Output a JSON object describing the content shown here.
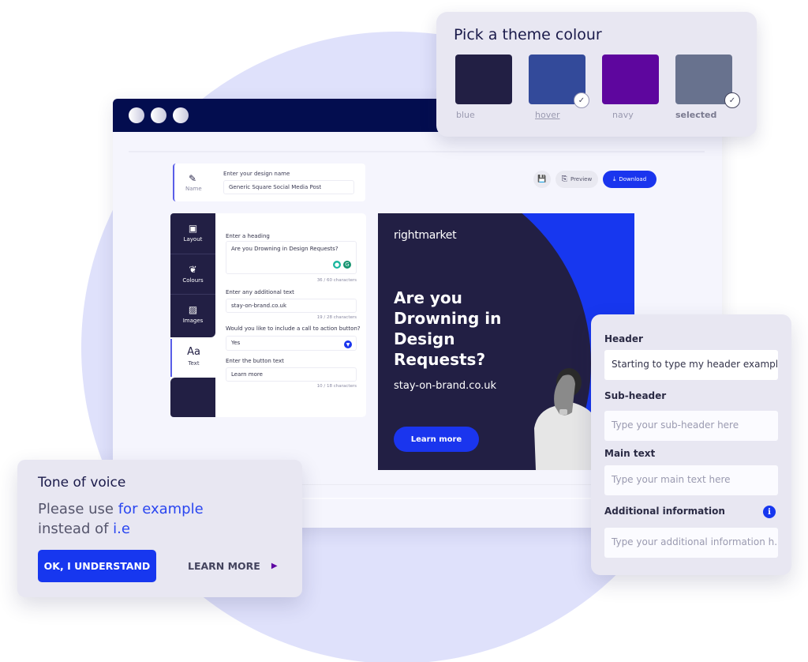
{
  "theme_picker": {
    "title": "Pick a theme colour",
    "swatches": [
      {
        "label": "blue",
        "color": "#221f44",
        "state": "default"
      },
      {
        "label": "hover",
        "color": "#334a9a",
        "state": "hover"
      },
      {
        "label": "navy",
        "color": "#5e069e",
        "state": "default"
      },
      {
        "label": "selected",
        "color": "#68728e",
        "state": "selected"
      }
    ],
    "check_glyph": "✓"
  },
  "window": {
    "titlebar_color": "#030d4f",
    "design_name": {
      "icon": "pencil-icon",
      "icon_glyph": "✎",
      "tab_label": "Name",
      "field_label": "Enter your design name",
      "value": "Generic Square Social Media Post"
    },
    "toolbar": {
      "save_glyph": "💾",
      "preview_glyph": "⎘",
      "preview_label": "Preview",
      "download_glyph": "⤓",
      "download_label": "Download"
    },
    "sidenav": [
      {
        "label": "Layout",
        "icon": "layout-icon",
        "glyph": "▣"
      },
      {
        "label": "Colours",
        "icon": "palette-icon",
        "glyph": "❦"
      },
      {
        "label": "Images",
        "icon": "image-icon",
        "glyph": "▨"
      },
      {
        "label": "Text",
        "icon": "text-icon",
        "glyph": "Aa",
        "active": true
      }
    ],
    "form": {
      "heading_label": "Enter a heading",
      "heading_value": "Are you Drowning in Design Requests?",
      "heading_count": "36 / 60 characters",
      "additional_label": "Enter any additional text",
      "additional_value": "stay-on-brand.co.uk",
      "additional_count": "19 / 28 characters",
      "cta_label": "Would you like to include a call to action button?",
      "cta_value": "Yes",
      "button_text_label": "Enter the button text",
      "button_text_value": "Learn more",
      "button_text_count": "10 / 18 characters"
    },
    "canvas": {
      "brand": "rightmarket",
      "headline": "Are you Drowning in Design Requests?",
      "url": "stay-on-brand.co.uk",
      "cta": "Learn more",
      "dark_color": "#221f44",
      "accent_color": "#1737ef"
    }
  },
  "tone_of_voice": {
    "title": "Tone of voice",
    "message_prefix": "Please use ",
    "message_highlight_1": "for example",
    "message_middle": "instead of ",
    "message_highlight_2": "i.e",
    "ok_button": "OK, I UNDERSTAND",
    "learn_more": "LEARN MORE",
    "arrow_glyph": "▶"
  },
  "content_form": {
    "header_label": "Header",
    "header_value": "Starting to type my header example",
    "subheader_label": "Sub-header",
    "subheader_placeholder": "Type your sub-header here",
    "main_label": "Main text",
    "main_placeholder": "Type your main text here",
    "additional_label": "Additional information",
    "additional_placeholder": "Type your additional information h...",
    "info_glyph": "i"
  }
}
